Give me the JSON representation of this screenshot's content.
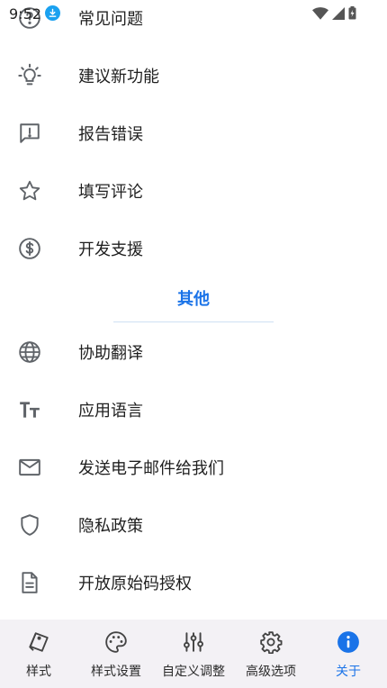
{
  "status_bar": {
    "time": "9:52"
  },
  "colors": {
    "accent": "#1a73e8",
    "icon": "#5f6368",
    "nav_background": "#f3f1f5"
  },
  "list": {
    "items": [
      {
        "label": "常见问题",
        "icon": "help-circle-icon"
      },
      {
        "label": "建议新功能",
        "icon": "lightbulb-icon"
      },
      {
        "label": "报告错误",
        "icon": "feedback-icon"
      },
      {
        "label": "填写评论",
        "icon": "star-icon"
      },
      {
        "label": "开发支援",
        "icon": "dollar-circle-icon"
      }
    ],
    "section_title": "其他",
    "other_items": [
      {
        "label": "协助翻译",
        "icon": "globe-icon"
      },
      {
        "label": "应用语言",
        "icon": "text-size-icon"
      },
      {
        "label": "发送电子邮件给我们",
        "icon": "mail-icon"
      },
      {
        "label": "隐私政策",
        "icon": "shield-icon"
      },
      {
        "label": "开放原始码授权",
        "icon": "document-icon"
      }
    ]
  },
  "bottom_nav": {
    "items": [
      {
        "label": "样式",
        "icon": "style-icon"
      },
      {
        "label": "样式设置",
        "icon": "palette-icon"
      },
      {
        "label": "自定义调整",
        "icon": "sliders-icon"
      },
      {
        "label": "高级选项",
        "icon": "gear-icon"
      },
      {
        "label": "关于",
        "icon": "info-icon",
        "active": true
      }
    ]
  }
}
